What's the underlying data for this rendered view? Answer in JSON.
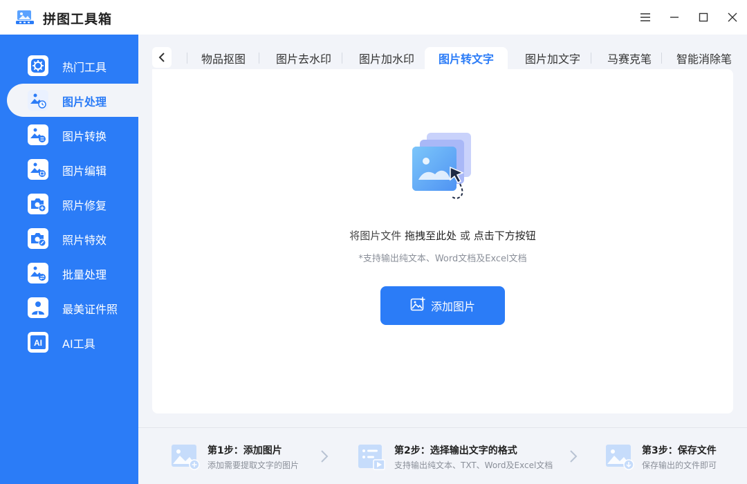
{
  "app": {
    "title": "拼图工具箱"
  },
  "window_controls": {
    "menu_icon": "menu-icon",
    "minimize_icon": "minimize-icon",
    "maximize_icon": "maximize-icon",
    "close_icon": "close-icon"
  },
  "colors": {
    "accent": "#2b7cf7",
    "sidebar_bg": "#2b7cf7",
    "main_bg": "#f2f4f9",
    "panel_bg": "#ffffff"
  },
  "sidebar": {
    "items": [
      {
        "label": "热门工具",
        "icon": "gear-icon",
        "active": false
      },
      {
        "label": "图片处理",
        "icon": "image-clock-icon",
        "active": true
      },
      {
        "label": "图片转换",
        "icon": "image-convert-icon",
        "active": false
      },
      {
        "label": "图片编辑",
        "icon": "image-edit-icon",
        "active": false
      },
      {
        "label": "照片修复",
        "icon": "camera-plus-icon",
        "active": false
      },
      {
        "label": "照片特效",
        "icon": "camera-wand-icon",
        "active": false
      },
      {
        "label": "批量处理",
        "icon": "image-batch-icon",
        "active": false
      },
      {
        "label": "最美证件照",
        "icon": "id-photo-icon",
        "active": false
      },
      {
        "label": "AI工具",
        "icon": "ai-icon",
        "active": false
      }
    ]
  },
  "tabs": {
    "items": [
      {
        "label": "物品抠图",
        "active": false
      },
      {
        "label": "图片去水印",
        "active": false
      },
      {
        "label": "图片加水印",
        "active": false
      },
      {
        "label": "图片转文字",
        "active": true
      },
      {
        "label": "图片加文字",
        "active": false
      },
      {
        "label": "马赛克笔",
        "active": false
      },
      {
        "label": "智能消除笔",
        "active": false
      }
    ]
  },
  "dropzone": {
    "hint_prefix": "将图片文件",
    "hint_drag": "拖拽至此处",
    "hint_or": "或",
    "hint_click": "点击下方按钮",
    "sub_hint": "*支持输出纯文本、Word文档及Excel文档",
    "button_label": "添加图片"
  },
  "steps": [
    {
      "title": "第1步：添加图片",
      "desc": "添加需要提取文字的图片",
      "icon": "image-add-icon"
    },
    {
      "title": "第2步：选择输出文字的格式",
      "desc": "支持输出纯文本、TXT、Word及Excel文档",
      "icon": "list-format-icon"
    },
    {
      "title": "第3步：保存文件",
      "desc": "保存输出的文件即可",
      "icon": "image-download-icon"
    }
  ]
}
